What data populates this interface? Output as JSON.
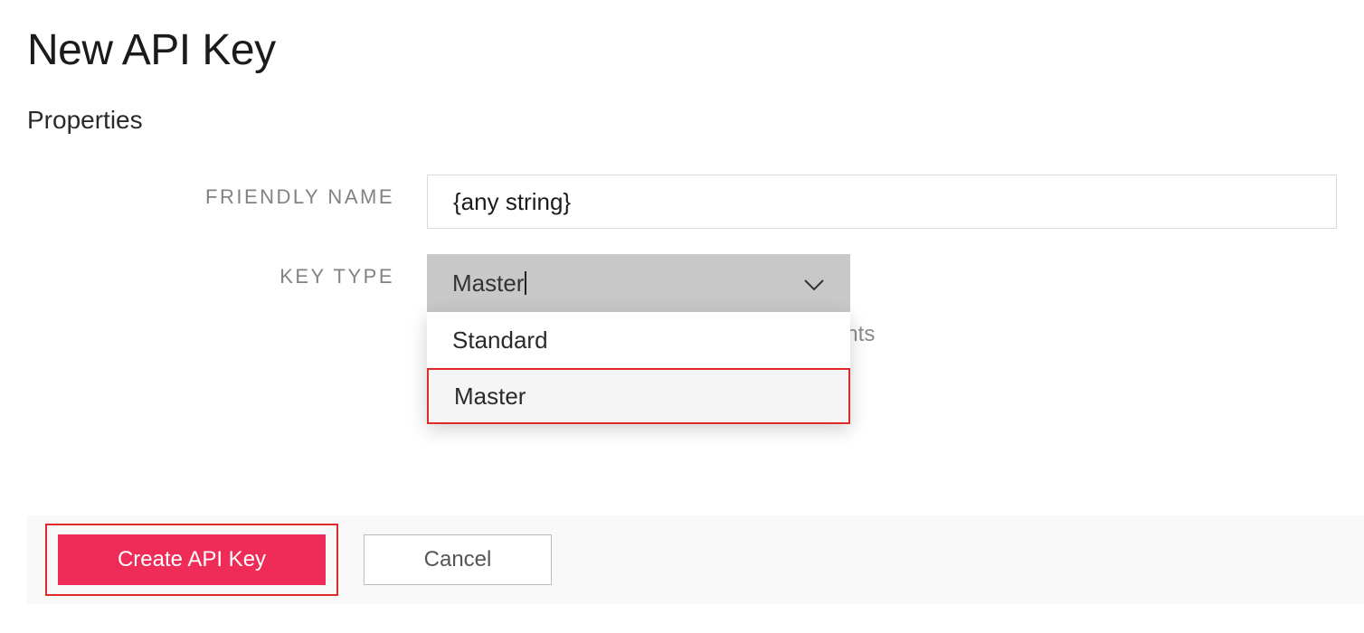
{
  "page": {
    "title": "New API Key",
    "section_title": "Properties"
  },
  "fields": {
    "friendly_name": {
      "label": "FRIENDLY NAME",
      "value": "{any string}"
    },
    "key_type": {
      "label": "KEY TYPE",
      "selected": "Master",
      "options": [
        "Standard",
        "Master"
      ],
      "help_text": "eys, Account Configuration, and Sub Accounts"
    }
  },
  "buttons": {
    "create": "Create API Key",
    "cancel": "Cancel"
  }
}
